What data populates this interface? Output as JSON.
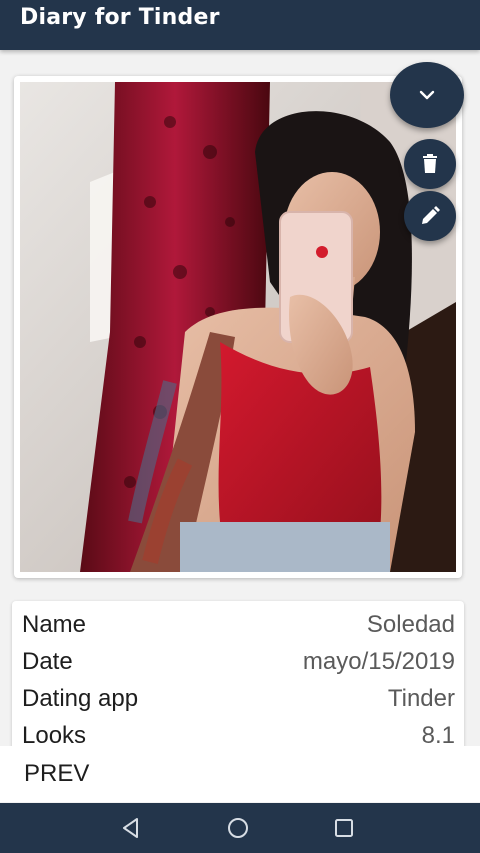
{
  "appbar": {
    "title": "Diary for Tinder"
  },
  "photo": {
    "alt": "Profile photo"
  },
  "actions": {
    "collapse_icon": "chevron-down-icon",
    "delete_icon": "trash-icon",
    "edit_icon": "pencil-icon"
  },
  "details": {
    "rows": [
      {
        "label": "Name",
        "value": "Soledad"
      },
      {
        "label": "Date",
        "value": "mayo/15/2019"
      },
      {
        "label": "Dating app",
        "value": "Tinder"
      },
      {
        "label": "Looks",
        "value": "8.1"
      }
    ]
  },
  "footer": {
    "prev_label": "PREV"
  },
  "navbar": {
    "icons": [
      "back-icon",
      "home-icon",
      "recents-icon"
    ]
  },
  "colors": {
    "primary": "#23354b",
    "background": "#f2f2f2",
    "card": "#ffffff"
  }
}
